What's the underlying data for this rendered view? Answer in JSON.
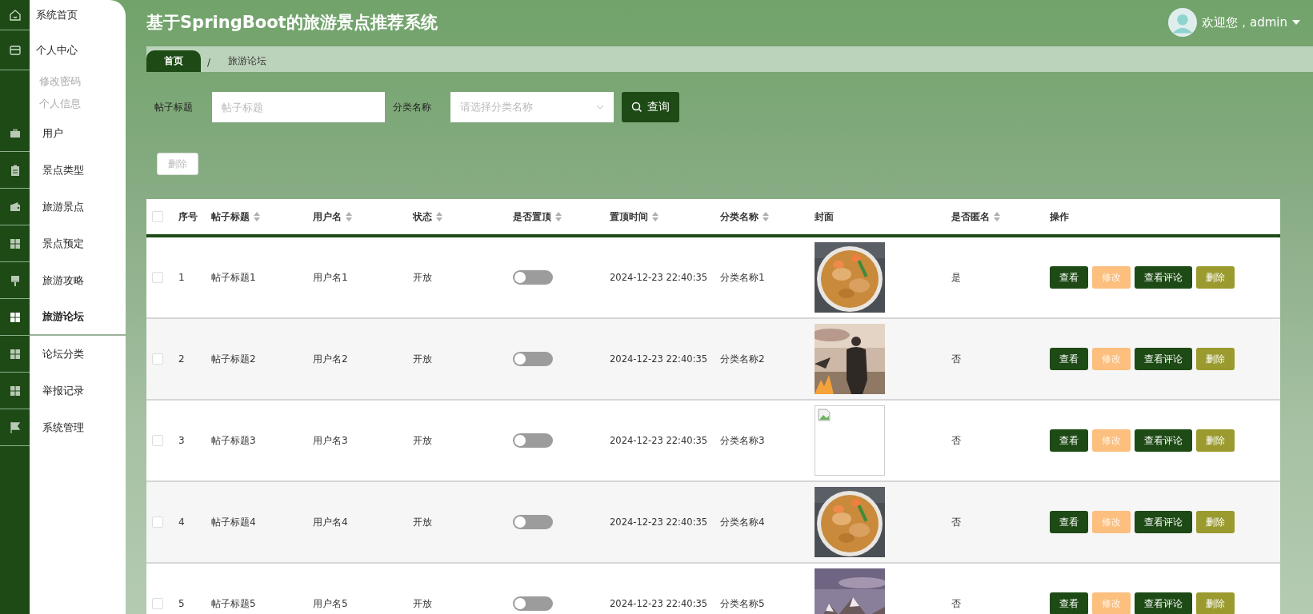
{
  "header": {
    "title": "基于SpringBoot的旅游景点推荐系统",
    "greeting": "欢迎您，admin"
  },
  "sidebar": {
    "items": [
      {
        "label": "系统首页",
        "selected": false
      },
      {
        "label": "个人中心",
        "selected": false,
        "children": [
          {
            "label": "修改密码",
            "selected": false
          },
          {
            "label": "个人信息",
            "selected": false
          }
        ]
      },
      {
        "label": "用户",
        "selected": false
      },
      {
        "label": "景点类型",
        "selected": false
      },
      {
        "label": "旅游景点",
        "selected": false
      },
      {
        "label": "景点预定",
        "selected": false
      },
      {
        "label": "旅游攻略",
        "selected": false
      },
      {
        "label": "旅游论坛",
        "selected": true
      },
      {
        "label": "论坛分类",
        "selected": false
      },
      {
        "label": "举报记录",
        "selected": false
      },
      {
        "label": "系统管理",
        "selected": false
      }
    ]
  },
  "breadcrumb": {
    "items": [
      {
        "label": "首页",
        "selected": true
      },
      {
        "label": "旅游论坛",
        "selected": false
      }
    ],
    "separator": "/"
  },
  "search": {
    "fields": [
      {
        "label": "帖子标题",
        "placeholder": "帖子标题",
        "kind": "text"
      },
      {
        "label": "分类名称",
        "placeholder": "请选择分类名称",
        "kind": "select"
      }
    ],
    "button": "查询"
  },
  "toolbar": {
    "delete_button": {
      "label": "删除",
      "disabled": true
    }
  },
  "table": {
    "select_all": {
      "checked": false
    },
    "columns": [
      {
        "label": "序号",
        "sortable": false
      },
      {
        "label": "帖子标题",
        "sortable": true
      },
      {
        "label": "用户名",
        "sortable": true
      },
      {
        "label": "状态",
        "sortable": true
      },
      {
        "label": "是否置顶",
        "sortable": true
      },
      {
        "label": "置顶时间",
        "sortable": true
      },
      {
        "label": "分类名称",
        "sortable": true
      },
      {
        "label": "封面",
        "sortable": false
      },
      {
        "label": "是否匿名",
        "sortable": true
      },
      {
        "label": "操作",
        "sortable": false
      }
    ],
    "rows": [
      {
        "checked": false,
        "index": "1",
        "title": "帖子标题1",
        "username": "用户名1",
        "status": "开放",
        "pinned": false,
        "pin_time": "2024-12-23 22:40:35",
        "category": "分类名称1",
        "cover": {
          "kind": "picture"
        },
        "anonymous": "是",
        "actions": [
          {
            "label": "查看",
            "kind": "view"
          },
          {
            "label": "修改",
            "kind": "edit"
          },
          {
            "label": "查看评论",
            "kind": "comments"
          },
          {
            "label": "删除",
            "kind": "delete"
          }
        ]
      },
      {
        "checked": false,
        "index": "2",
        "title": "帖子标题2",
        "username": "用户名2",
        "status": "开放",
        "pinned": false,
        "pin_time": "2024-12-23 22:40:35",
        "category": "分类名称2",
        "cover": {
          "kind": "picture"
        },
        "anonymous": "否",
        "actions": [
          {
            "label": "查看",
            "kind": "view"
          },
          {
            "label": "修改",
            "kind": "edit"
          },
          {
            "label": "查看评论",
            "kind": "comments"
          },
          {
            "label": "删除",
            "kind": "delete"
          }
        ]
      },
      {
        "checked": false,
        "index": "3",
        "title": "帖子标题3",
        "username": "用户名3",
        "status": "开放",
        "pinned": false,
        "pin_time": "2024-12-23 22:40:35",
        "category": "分类名称3",
        "cover": {
          "kind": "broken"
        },
        "anonymous": "否",
        "actions": [
          {
            "label": "查看",
            "kind": "view"
          },
          {
            "label": "修改",
            "kind": "edit"
          },
          {
            "label": "查看评论",
            "kind": "comments"
          },
          {
            "label": "删除",
            "kind": "delete"
          }
        ]
      },
      {
        "checked": false,
        "index": "4",
        "title": "帖子标题4",
        "username": "用户名4",
        "status": "开放",
        "pinned": false,
        "pin_time": "2024-12-23 22:40:35",
        "category": "分类名称4",
        "cover": {
          "kind": "picture"
        },
        "anonymous": "否",
        "actions": [
          {
            "label": "查看",
            "kind": "view"
          },
          {
            "label": "修改",
            "kind": "edit"
          },
          {
            "label": "查看评论",
            "kind": "comments"
          },
          {
            "label": "删除",
            "kind": "delete"
          }
        ]
      },
      {
        "checked": false,
        "index": "5",
        "title": "帖子标题5",
        "username": "用户名5",
        "status": "开放",
        "pinned": false,
        "pin_time": "2024-12-23 22:40:35",
        "category": "分类名称5",
        "cover": {
          "kind": "picture"
        },
        "anonymous": "否",
        "actions": [
          {
            "label": "查看",
            "kind": "view"
          },
          {
            "label": "修改",
            "kind": "edit"
          },
          {
            "label": "查看评论",
            "kind": "comments"
          },
          {
            "label": "删除",
            "kind": "delete"
          }
        ]
      }
    ]
  }
}
